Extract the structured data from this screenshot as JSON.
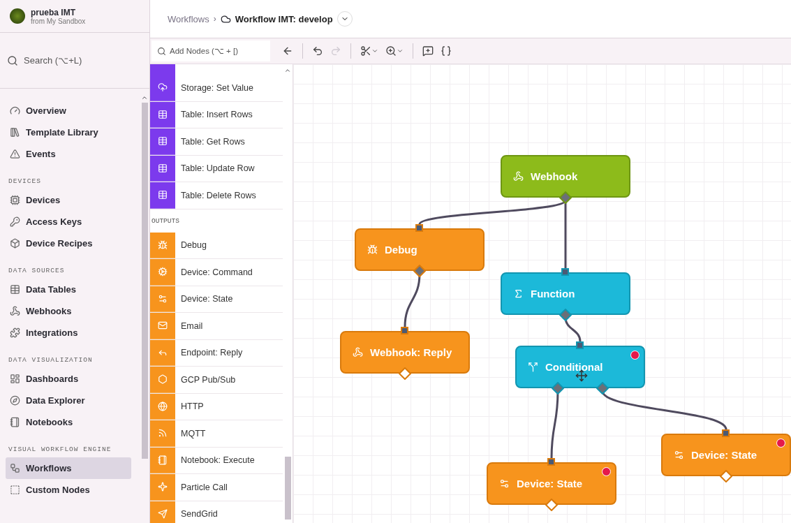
{
  "org": {
    "name": "prueba IMT",
    "subtitle": "from My Sandbox"
  },
  "sidebar": {
    "search_placeholder": "Search (⌥+L)",
    "groups": [
      {
        "items": [
          {
            "kind": "overview",
            "label": "Overview",
            "selected": false
          },
          {
            "kind": "template",
            "label": "Template Library",
            "selected": false
          },
          {
            "kind": "events",
            "label": "Events",
            "selected": false
          }
        ]
      },
      {
        "title": "DEVICES",
        "items": [
          {
            "kind": "devices",
            "label": "Devices",
            "selected": false
          },
          {
            "kind": "keys",
            "label": "Access Keys",
            "selected": false
          },
          {
            "kind": "recipes",
            "label": "Device Recipes",
            "selected": false
          }
        ]
      },
      {
        "title": "DATA SOURCES",
        "items": [
          {
            "kind": "tables",
            "label": "Data Tables",
            "selected": false
          },
          {
            "kind": "webhooks",
            "label": "Webhooks",
            "selected": false
          },
          {
            "kind": "integrations",
            "label": "Integrations",
            "selected": false
          }
        ]
      },
      {
        "title": "DATA VISUALIZATION",
        "items": [
          {
            "kind": "dashboards",
            "label": "Dashboards",
            "selected": false
          },
          {
            "kind": "explorer",
            "label": "Data Explorer",
            "selected": false
          },
          {
            "kind": "notebooks",
            "label": "Notebooks",
            "selected": false
          }
        ]
      },
      {
        "title": "VISUAL WORKFLOW ENGINE",
        "items": [
          {
            "kind": "workflows",
            "label": "Workflows",
            "selected": true
          },
          {
            "kind": "custom",
            "label": "Custom Nodes",
            "selected": false
          }
        ]
      }
    ]
  },
  "breadcrumb": {
    "parent": "Workflows",
    "separator": "›",
    "current": "Workflow IMT: develop"
  },
  "toolbar": {
    "search_placeholder": "Add Nodes (⌥ + [)",
    "tools": [
      {
        "kind": "back",
        "disabled": false
      },
      {
        "kind": "undo",
        "disabled": false
      },
      {
        "kind": "redo",
        "disabled": true
      },
      {
        "kind": "cut",
        "disabled": false
      },
      {
        "kind": "zoom",
        "disabled": false
      },
      {
        "kind": "comment",
        "disabled": false
      },
      {
        "kind": "variables",
        "disabled": false
      }
    ]
  },
  "palette": {
    "groups": [
      {
        "items": [
          {
            "kind": "storage",
            "label": "Storage: Set Value"
          },
          {
            "kind": "table",
            "label": "Table: Insert Rows"
          },
          {
            "kind": "table",
            "label": "Table: Get Rows"
          },
          {
            "kind": "table",
            "label": "Table: Update Row"
          },
          {
            "kind": "table",
            "label": "Table: Delete Rows"
          }
        ]
      },
      {
        "title": "OUTPUTS",
        "items": [
          {
            "kind": "debug",
            "label": "Debug"
          },
          {
            "kind": "command",
            "label": "Device: Command"
          },
          {
            "kind": "state",
            "label": "Device: State"
          },
          {
            "kind": "email",
            "label": "Email"
          },
          {
            "kind": "reply",
            "label": "Endpoint: Reply"
          },
          {
            "kind": "pubsub",
            "label": "GCP Pub/Sub"
          },
          {
            "kind": "http",
            "label": "HTTP"
          },
          {
            "kind": "mqtt",
            "label": "MQTT"
          },
          {
            "kind": "notebook",
            "label": "Notebook: Execute"
          },
          {
            "kind": "particle",
            "label": "Particle Call"
          },
          {
            "kind": "sendgrid",
            "label": "SendGrid"
          }
        ]
      }
    ]
  },
  "canvas": {
    "nodes": [
      {
        "kind": "trigger",
        "label": "Webhook",
        "error": false
      },
      {
        "kind": "output",
        "label": "Debug",
        "error": false
      },
      {
        "kind": "logic",
        "label": "Function",
        "error": false
      },
      {
        "kind": "output",
        "label": "Webhook: Reply",
        "error": false
      },
      {
        "kind": "branch",
        "label": "Conditional",
        "error": true
      },
      {
        "kind": "output",
        "label": "Device: State",
        "error": true
      },
      {
        "kind": "output",
        "label": "Device: State",
        "error": true
      }
    ]
  }
}
